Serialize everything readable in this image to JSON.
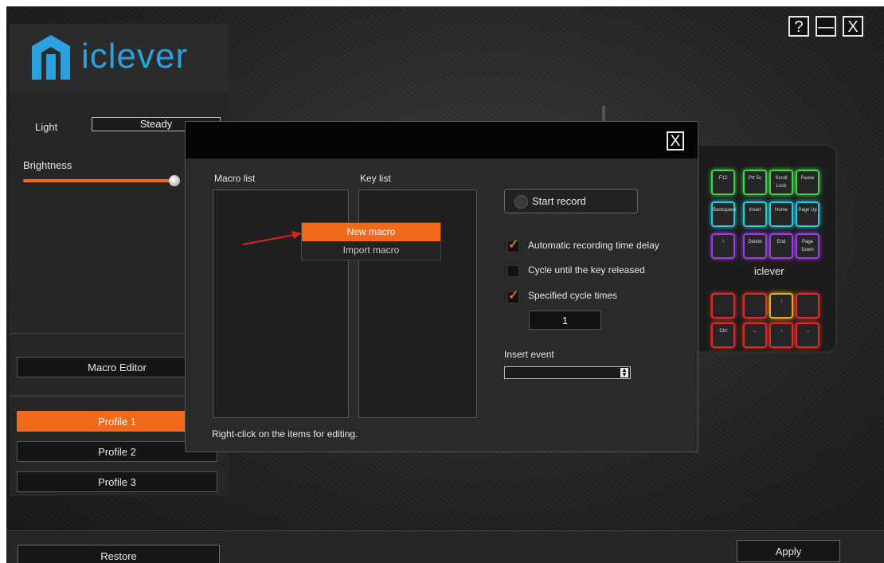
{
  "app": {
    "brand": "iclever",
    "brand_color": "#2aa1de",
    "accent": "#f06a1b"
  },
  "window": {
    "help_label": "?",
    "minimize_label": "—",
    "close_label": "X"
  },
  "sidebar": {
    "light_label": "Light",
    "light_mode": "Steady",
    "brightness_label": "Brightness",
    "brightness_level": 0.95,
    "macro_editor_label": "Macro Editor",
    "profiles": [
      "Profile 1",
      "Profile 2",
      "Profile 3"
    ],
    "active_profile": "Profile 1"
  },
  "footer": {
    "restore_label": "Restore",
    "apply_label": "Apply"
  },
  "dialog": {
    "close_label": "X",
    "macro_list_label": "Macro list",
    "key_list_label": "Key list",
    "context_menu": {
      "items": [
        "New macro",
        "Import macro"
      ],
      "selected": "New macro"
    },
    "start_record_label": "Start record",
    "options": [
      {
        "label": "Automatic recording time delay",
        "checked": true
      },
      {
        "label": "Cycle until the key released",
        "checked": false
      },
      {
        "label": "Specified cycle times",
        "checked": true
      }
    ],
    "cycle_times": "1",
    "insert_event_label": "Insert event",
    "insert_event_value": "",
    "hint": "Right-click on the items for editing."
  },
  "keyboard": {
    "logo_text": "iclever",
    "keys": [
      {
        "label": "F12",
        "color": "#3fd14a"
      },
      {
        "label": "Prt Sc",
        "color": "#3fd14a"
      },
      {
        "label": "Scroll Lock",
        "color": "#3fd14a"
      },
      {
        "label": "Pause",
        "color": "#3fd14a"
      },
      {
        "label": "Backspace",
        "color": "#27c8d8"
      },
      {
        "label": "Insert",
        "color": "#27c8d8"
      },
      {
        "label": "Home",
        "color": "#27c8d8"
      },
      {
        "label": "Page Up",
        "color": "#27c8d8"
      },
      {
        "label": "\\",
        "color": "#9b3ee0"
      },
      {
        "label": "Delete",
        "color": "#9b3ee0"
      },
      {
        "label": "End",
        "color": "#9b3ee0"
      },
      {
        "label": "Page Down",
        "color": "#9b3ee0"
      },
      {
        "label": "",
        "color": "#e02a2a"
      },
      {
        "label": "",
        "color": "#e02a2a"
      },
      {
        "label": "↑",
        "color": "#e8b020"
      },
      {
        "label": "",
        "color": "#e02a2a"
      },
      {
        "label": "Ctrl",
        "color": "#e02a2a"
      },
      {
        "label": "←",
        "color": "#e02a2a"
      },
      {
        "label": "↓",
        "color": "#e02a2a"
      },
      {
        "label": "→",
        "color": "#e02a2a"
      }
    ]
  }
}
